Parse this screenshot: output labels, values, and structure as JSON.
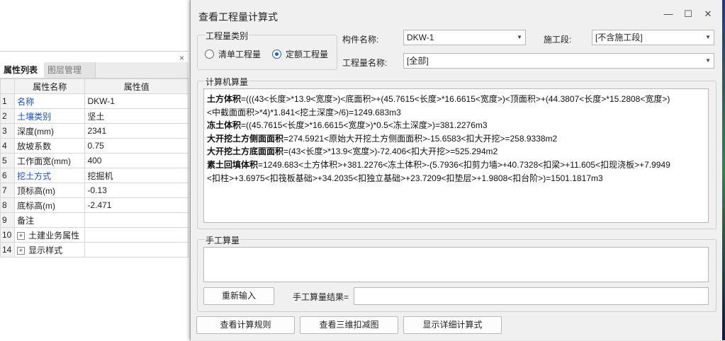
{
  "properties_panel": {
    "close_glyph": "×",
    "tabs": [
      "属性列表",
      "图层管理"
    ],
    "header": {
      "name": "属性名称",
      "value": "属性值"
    },
    "rows": [
      {
        "num": "1",
        "name": "名称",
        "value": "DKW-1",
        "blue": true,
        "expand": false
      },
      {
        "num": "2",
        "name": "土壤类别",
        "value": "坚土",
        "blue": true,
        "expand": false
      },
      {
        "num": "3",
        "name": "深度(mm)",
        "value": "2341",
        "blue": false,
        "expand": false
      },
      {
        "num": "4",
        "name": "放坡系数",
        "value": "0.75",
        "blue": false,
        "expand": false
      },
      {
        "num": "5",
        "name": "工作面宽(mm)",
        "value": "400",
        "blue": false,
        "expand": false
      },
      {
        "num": "6",
        "name": "挖土方式",
        "value": "挖掘机",
        "blue": true,
        "expand": false
      },
      {
        "num": "7",
        "name": "顶标高(m)",
        "value": "-0.13",
        "blue": false,
        "expand": false
      },
      {
        "num": "8",
        "name": "底标高(m)",
        "value": "-2.471",
        "blue": false,
        "expand": false
      },
      {
        "num": "9",
        "name": "备注",
        "value": "",
        "blue": false,
        "expand": false
      },
      {
        "num": "10",
        "name": "土建业务属性",
        "value": "",
        "blue": false,
        "expand": true
      },
      {
        "num": "14",
        "name": "显示样式",
        "value": "",
        "blue": false,
        "expand": true
      }
    ]
  },
  "dialog": {
    "title": "查看工程量计算式",
    "window_buttons": {
      "minimize": "—",
      "maximize": "☐",
      "close": "✕"
    },
    "quantity_type": {
      "label": "工程量类别",
      "options": [
        "清单工程量",
        "定额工程量"
      ],
      "selected": "定额工程量"
    },
    "component_name": {
      "label": "构件名称:",
      "value": "DKW-1"
    },
    "construction_section": {
      "label": "施工段:",
      "value": "[不含施工段]"
    },
    "quantity_name": {
      "label": "工程量名称:",
      "value": "[全部]"
    },
    "computer_calc": {
      "label": "计算机算量",
      "lines": [
        {
          "term": "土方体积",
          "expr": "=(((43<长度>*13.9<宽度>)<底面积>+(45.7615<长度>*16.6615<宽度>)<顶面积>+(44.3807<长度>*15.2808<宽度>)"
        },
        {
          "term": "",
          "expr": "<中截面面积>*4)*1.841<挖土深度>/6)=1249.683m3"
        },
        {
          "term": "冻土体积",
          "expr": "=((45.7615<长度>*16.6615<宽度>)*0.5<冻土深度>)=381.2276m3"
        },
        {
          "term": "大开挖土方侧面面积",
          "expr": "=274.5921<原始大开挖土方侧面面积>-15.6583<扣大开挖>=258.9338m2"
        },
        {
          "term": "大开挖土方底面面积",
          "expr": "=(43<长度>*13.9<宽度>)-72.406<扣大开挖>=525.294m2"
        },
        {
          "term": "素土回填体积",
          "expr": "=1249.683<土方体积>+381.2276<冻土体积>-(5.7936<扣剪力墙>+40.7328<扣梁>+11.605<扣现浇板>+7.9949"
        },
        {
          "term": "",
          "expr": "<扣柱>+3.6975<扣筏板基础>+34.2035<扣独立基础>+23.7209<扣垫层>+1.9808<扣台阶>)=1501.1817m3"
        }
      ]
    },
    "manual_calc": {
      "label": "手工算量",
      "reenter_button": "重新输入",
      "result_label": "手工算量结果=",
      "result_value": ""
    },
    "bottom_buttons": [
      "查看计算规则",
      "查看三维扣减图",
      "显示详细计算式"
    ]
  }
}
